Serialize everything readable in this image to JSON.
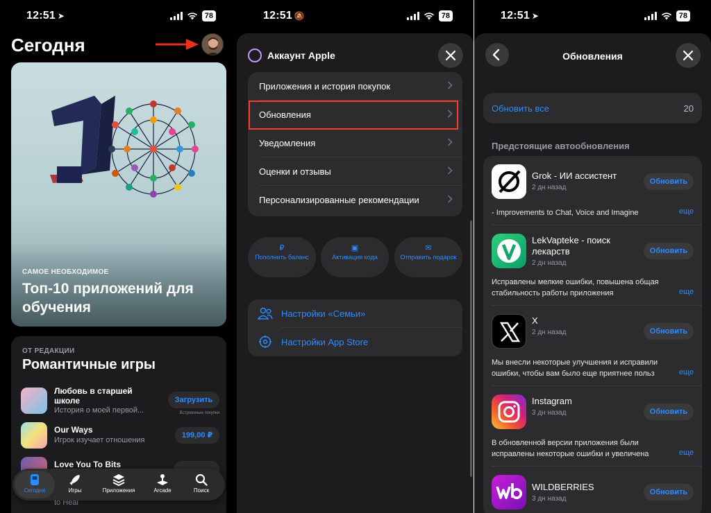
{
  "status": {
    "left": {
      "time": "12:51",
      "glyph": "➤",
      "battery": "78"
    },
    "middle": {
      "time": "12:51",
      "glyph": "🔕",
      "battery": "78"
    },
    "right": {
      "time": "12:51",
      "glyph": "➤",
      "battery": "78"
    }
  },
  "today": {
    "title": "Сегодня",
    "hero": {
      "kicker": "САМОЕ НЕОБХОДИМОЕ",
      "title": "Топ-10 приложений для обучения"
    },
    "editorial": {
      "kicker": "ОТ РЕДАКЦИИ",
      "title": "Романтичные игры",
      "games": [
        {
          "name": "Любовь в старшей школе",
          "subtitle": "История о моей первой...",
          "button": "Загрузить",
          "note": "Встроенные покупки"
        },
        {
          "name": "Our Ways",
          "subtitle": "Игрок изучает отношения",
          "button": "199,00 ₽"
        },
        {
          "name": "Love You To Bits",
          "subtitle": "to Heal",
          "button": ""
        }
      ]
    },
    "tabs": [
      {
        "label": "Сегодня",
        "icon": "today-icon"
      },
      {
        "label": "Игры",
        "icon": "rocket-icon"
      },
      {
        "label": "Приложения",
        "icon": "layers-icon"
      },
      {
        "label": "Arcade",
        "icon": "joystick-icon"
      },
      {
        "label": "Поиск",
        "icon": "search-icon"
      }
    ]
  },
  "account": {
    "title": "Аккаунт Apple",
    "menu": [
      "Приложения и история покупок",
      "Обновления",
      "Уведомления",
      "Оценки и отзывы",
      "Персонализированные рекомендации"
    ],
    "quick": [
      {
        "icon": "₽",
        "label": "Пополнить баланс"
      },
      {
        "icon": "▣",
        "label": "Активация кода"
      },
      {
        "icon": "✉",
        "label": "Отправить подарок"
      }
    ],
    "links": [
      {
        "label": "Настройки «Семьи»",
        "icon": "family-icon"
      },
      {
        "label": "Настройки App Store",
        "icon": "gear-icon"
      }
    ]
  },
  "updates": {
    "title": "Обновления",
    "update_all": "Обновить все",
    "count": "20",
    "section": "Предстоящие автообновления",
    "apps": [
      {
        "name": "Grok - ИИ ассистент",
        "date": "2 дн назад",
        "button": "Обновить",
        "notes": [
          "- Improvements to Chat, Voice and Imagine"
        ],
        "more": "еще"
      },
      {
        "name": "LekVapteke - поиск лекарств",
        "date": "2 дн назад",
        "button": "Обновить",
        "notes": [
          "Исправлены мелкие ошибки, повышена общая",
          "стабильность работы приложения"
        ],
        "more": "еще"
      },
      {
        "name": "X",
        "date": "2 дн назад",
        "button": "Обновить",
        "notes": [
          "Мы внесли некоторые улучшения и исправили",
          "ошибки, чтобы вам было еще приятнее польз"
        ],
        "more": "еще"
      },
      {
        "name": "Instagram",
        "date": "3 дн назад",
        "button": "Обновить",
        "notes": [
          "В обновленной версии приложения были",
          "исправлены некоторые ошибки и увеличена"
        ],
        "more": "еще"
      },
      {
        "name": "WILDBERRIES",
        "date": "3 дн назад",
        "button": "Обновить",
        "notes": [],
        "more": ""
      }
    ]
  },
  "colors": {
    "accent": "#2b8cff",
    "highlight": "#ff3b30",
    "arrow": "#e8321e"
  }
}
